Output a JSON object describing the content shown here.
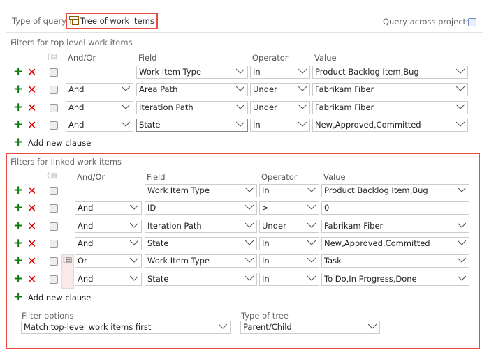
{
  "header": {
    "type_label": "Type of query",
    "type_value": "Tree of work items",
    "type_icon": "tree-query-icon",
    "across_label": "Query across projects",
    "across_checked": false
  },
  "columns": {
    "andor": "And/Or",
    "field": "Field",
    "operator": "Operator",
    "value": "Value"
  },
  "top": {
    "title": "Filters for top level work items",
    "add_label": "Add new clause",
    "rows": [
      {
        "andor": "",
        "field": "Work Item Type",
        "operator": "In",
        "value": "Product Backlog Item,Bug"
      },
      {
        "andor": "And",
        "field": "Area Path",
        "operator": "Under",
        "value": "Fabrikam Fiber"
      },
      {
        "andor": "And",
        "field": "Iteration Path",
        "operator": "Under",
        "value": "Fabrikam Fiber"
      },
      {
        "andor": "And",
        "field": "State",
        "operator": "In",
        "value": "New,Approved,Committed"
      }
    ]
  },
  "linked": {
    "title": "Filters for linked work items",
    "add_label": "Add new clause",
    "rows": [
      {
        "andor": "",
        "field": "Work Item Type",
        "operator": "In",
        "value": "Product Backlog Item,Bug"
      },
      {
        "andor": "And",
        "field": "ID",
        "operator": ">",
        "value": "0",
        "value_plain": true
      },
      {
        "andor": "And",
        "field": "Iteration Path",
        "operator": "Under",
        "value": "Fabrikam Fiber"
      },
      {
        "andor": "And",
        "field": "State",
        "operator": "In",
        "value": "New,Approved,Committed"
      },
      {
        "andor": "Or",
        "field": "Work Item Type",
        "operator": "In",
        "value": "Task"
      },
      {
        "andor": "And",
        "field": "State",
        "operator": "In",
        "value": "To Do,In Progress,Done"
      }
    ],
    "filter_options_label": "Filter options",
    "filter_options_value": "Match top-level work items first",
    "tree_type_label": "Type of tree",
    "tree_type_value": "Parent/Child"
  },
  "colors": {
    "accent_red": "#e74c3c",
    "add_green": "#107c10",
    "delete_red": "#dd0000"
  }
}
